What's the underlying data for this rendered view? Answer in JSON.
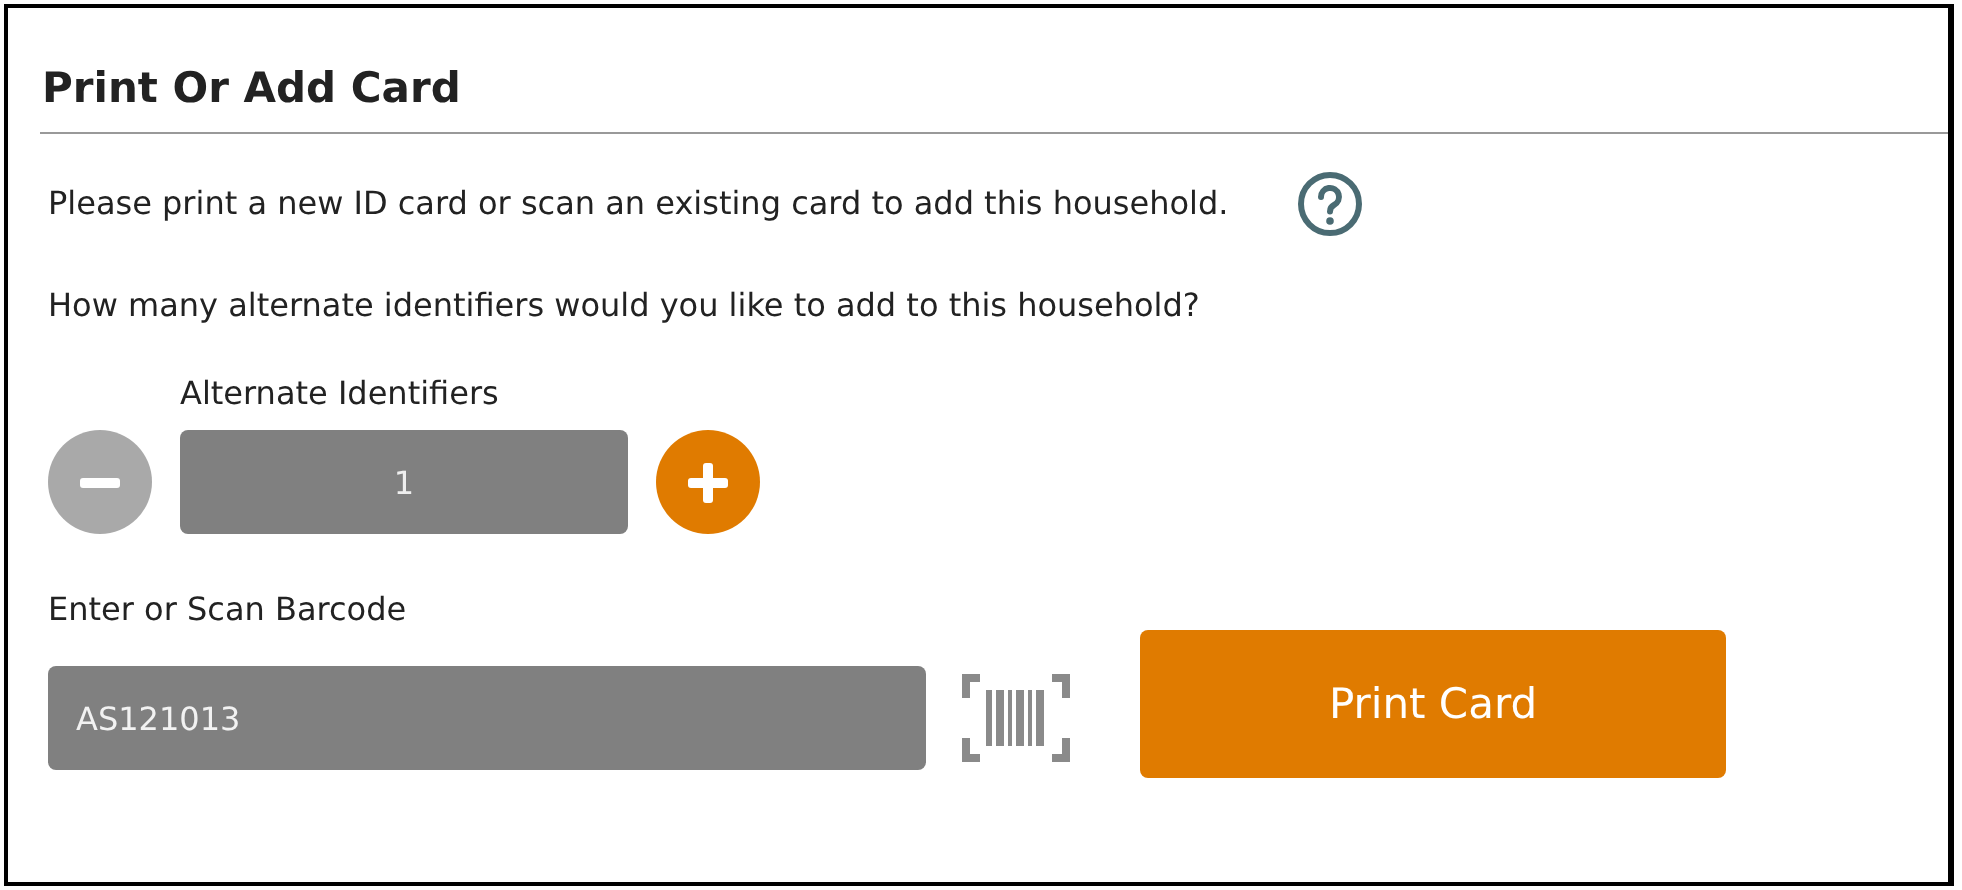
{
  "title": "Print Or Add Card",
  "instructions": [
    "Please print a new ID card or scan an existing card to add this household.",
    "How many alternate identifiers would you like to add to this household?"
  ],
  "counter": {
    "label": "Alternate Identifiers",
    "value": "1",
    "decrement_disabled": true,
    "increment_disabled": false
  },
  "barcode": {
    "label": "Enter or Scan Barcode",
    "value": "AS121013"
  },
  "print_button": {
    "label": "Print Card",
    "disabled": false
  }
}
